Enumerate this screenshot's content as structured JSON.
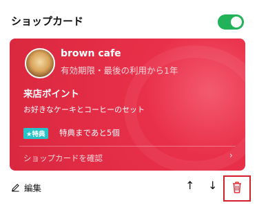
{
  "header": {
    "title": "ショップカード",
    "toggle_on": true
  },
  "card": {
    "cafe_name": "brown cafe",
    "validity": "有効期限・最後の利用から1年",
    "visit_title": "来店ポイント",
    "visit_desc": "お好きなケーキとコーヒーのセット",
    "badge": "★特典",
    "badge_text": "特典まであと5個",
    "confirm_label": "ショップカードを確認",
    "chevron_icon": "chevron-right-icon",
    "color": "#e22c45"
  },
  "footer": {
    "edit_label": "編集",
    "up_icon": "↑",
    "down_icon": "↓",
    "trash_icon": "trash-icon",
    "highlight_color": "#d31f2c"
  }
}
